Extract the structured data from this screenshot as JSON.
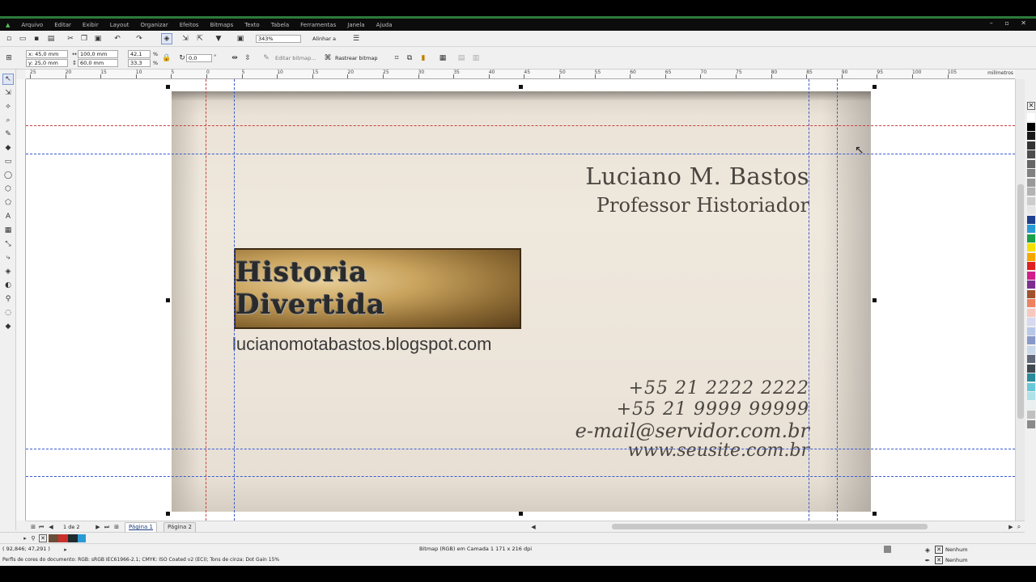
{
  "menu": [
    "Arquivo",
    "Editar",
    "Exibir",
    "Layout",
    "Organizar",
    "Efeitos",
    "Bitmaps",
    "Texto",
    "Tabela",
    "Ferramentas",
    "Janela",
    "Ajuda"
  ],
  "toolbar": {
    "zoom": "343%",
    "align_label": "Alinhar a",
    "x": "x: 45,0 mm",
    "y": "y: 25,0 mm",
    "width": "100,0 mm",
    "height": "60,0 mm",
    "scale_x": "42,1",
    "scale_y": "33,3",
    "percent": "%",
    "rotation": "0,0",
    "degree": "°",
    "edit_bitmap_label": "Editar bitmap...",
    "trace_bitmap_label": "Rastrear bitmap"
  },
  "ruler": {
    "unit": "milímetros",
    "labels": [
      "25",
      "20",
      "15",
      "10",
      "5",
      "0",
      "5",
      "10",
      "15",
      "20",
      "25",
      "30",
      "35",
      "40",
      "45",
      "50",
      "55",
      "60",
      "65",
      "70",
      "75",
      "80",
      "85",
      "90",
      "95",
      "100",
      "105"
    ]
  },
  "card": {
    "name": "Luciano M. Bastos",
    "role": "Professor Historiador",
    "logo_text": "Historia Divertida",
    "blog": "lucianomotabastos.blogspot.com",
    "phone1": "+55 21 2222 2222",
    "phone2": "+55 21 9999 99999",
    "email": "e-mail@servidor.com.br",
    "website": "www.seusite.com.br"
  },
  "page_nav": {
    "counter": "1 de 2",
    "tabs": [
      "Página 1",
      "Página 2"
    ]
  },
  "status": {
    "coords": "( 92,846; 47,291 )",
    "object_info": "Bitmap (RGB) em Camada 1 171 x 216 dpi",
    "color_profile": "Perfis de cores do documento: RGB: sRGB IEC61966-2.1; CMYK: ISO Coated v2 (ECI); Tons de cinza: Dot Gain 15%",
    "fill": "Nenhum",
    "outline": "Nenhum"
  },
  "colors": {
    "accent_green": "#2c7a3a",
    "card_paper": "#ece4d9",
    "card_text": "#4a4540",
    "guide_blue": "#3a5bd0",
    "guide_red": "#c84040"
  },
  "palette": [
    "#ffffff",
    "#000000",
    "#1a1a1a",
    "#333333",
    "#4d4d4d",
    "#666666",
    "#808080",
    "#999999",
    "#b3b3b3",
    "#cccccc",
    "#e6e6e6",
    "#1f3f8f",
    "#2a9ad6",
    "#1aa04a",
    "#f4e000",
    "#f7a600",
    "#e02020",
    "#d0208a",
    "#7d2f91",
    "#a0522d",
    "#f08060",
    "#f8c8c0",
    "#d8d8f0",
    "#b8c8e8",
    "#8898c8",
    "#c8d8e8",
    "#606878",
    "#404850",
    "#2a8a9a",
    "#6ac8d8",
    "#b0e0e8",
    "#e8f0f0",
    "#c0c0c0",
    "#8a8a8a"
  ]
}
